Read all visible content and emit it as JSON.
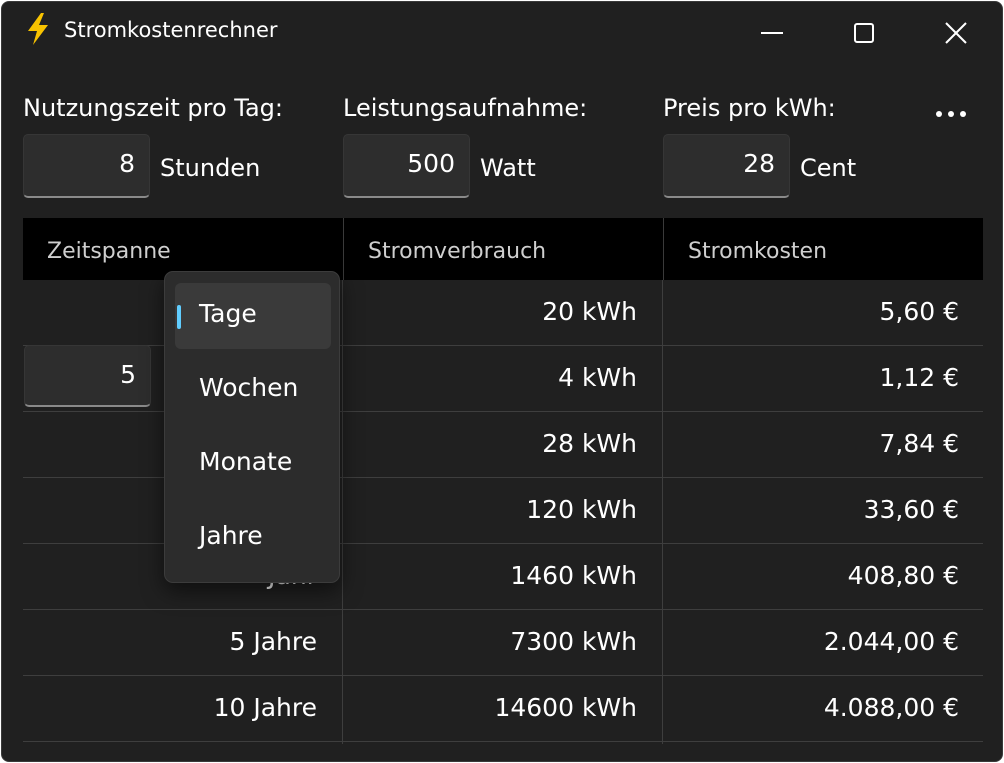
{
  "window": {
    "title": "Stromkostenrechner",
    "icon": "lightning-bolt-icon",
    "accent_color": "#60cdff",
    "icon_color": "#f8c300"
  },
  "inputs": {
    "usage": {
      "label": "Nutzungszeit pro Tag:",
      "value": "8",
      "unit": "Stunden"
    },
    "power": {
      "label": "Leistungsaufnahme:",
      "value": "500",
      "unit": "Watt"
    },
    "price": {
      "label": "Preis pro kWh:",
      "value": "28",
      "unit": "Cent"
    }
  },
  "table": {
    "headers": [
      "Zeitspanne",
      "Stromverbrauch",
      "Stromkosten"
    ],
    "span_value": "5",
    "rows": [
      {
        "period": "",
        "consumption": "20 kWh",
        "cost": "5,60 €"
      },
      {
        "period": "",
        "consumption": "4 kWh",
        "cost": "1,12 €"
      },
      {
        "period": "",
        "consumption": "28 kWh",
        "cost": "7,84 €"
      },
      {
        "period": "",
        "consumption": "120 kWh",
        "cost": "33,60 €"
      },
      {
        "period": "Jahr",
        "consumption": "1460 kWh",
        "cost": "408,80 €"
      },
      {
        "period": "5 Jahre",
        "consumption": "7300 kWh",
        "cost": "2.044,00 €"
      },
      {
        "period": "10 Jahre",
        "consumption": "14600 kWh",
        "cost": "4.088,00 €"
      }
    ]
  },
  "dropdown": {
    "selected": "Tage",
    "options": [
      "Tage",
      "Wochen",
      "Monate",
      "Jahre"
    ]
  }
}
